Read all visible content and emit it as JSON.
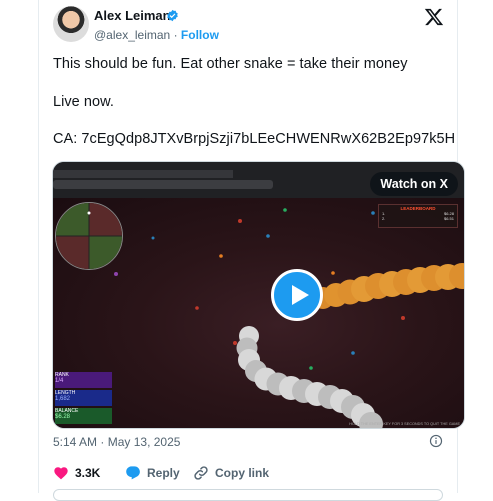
{
  "author": {
    "name": "Alex Leiman",
    "handle": "@alex_leiman",
    "separator": "·",
    "follow_label": "Follow"
  },
  "tweet": {
    "line1": "This should be fun. Eat other snake = take their money",
    "line2": "Live now.",
    "line3": "CA: 7cEgQdp8JTXvBrpjSzji7bLEeCHWENRwX62B2Ep97k5H"
  },
  "media": {
    "watch_label": "Watch on X",
    "game": {
      "leaderboard_title": "LEADERBOARD",
      "leaderboard_rows": [
        {
          "rank": "1.",
          "value": "$6.28"
        },
        {
          "rank": "2.",
          "value": "$6.51"
        }
      ],
      "stats": [
        {
          "label": "RANK",
          "value": "1/4",
          "color": "#4a1a7a"
        },
        {
          "label": "LENGTH",
          "value": "1,682",
          "color": "#1a2a8a"
        },
        {
          "label": "BALANCE",
          "value": "$6.28",
          "color": "#1a5a2a"
        }
      ],
      "hint": "HOLD THE ENTER KEY FOR 3 SECONDS TO QUIT THE GAME"
    }
  },
  "meta": {
    "time": "5:14 AM",
    "date": "May 13, 2025",
    "separator": "·"
  },
  "actions": {
    "likes": "3.3K",
    "reply_label": "Reply",
    "copy_link_label": "Copy link"
  },
  "colors": {
    "accent": "#1d9bf0",
    "like": "#f91880",
    "secondary_text": "#536471"
  }
}
